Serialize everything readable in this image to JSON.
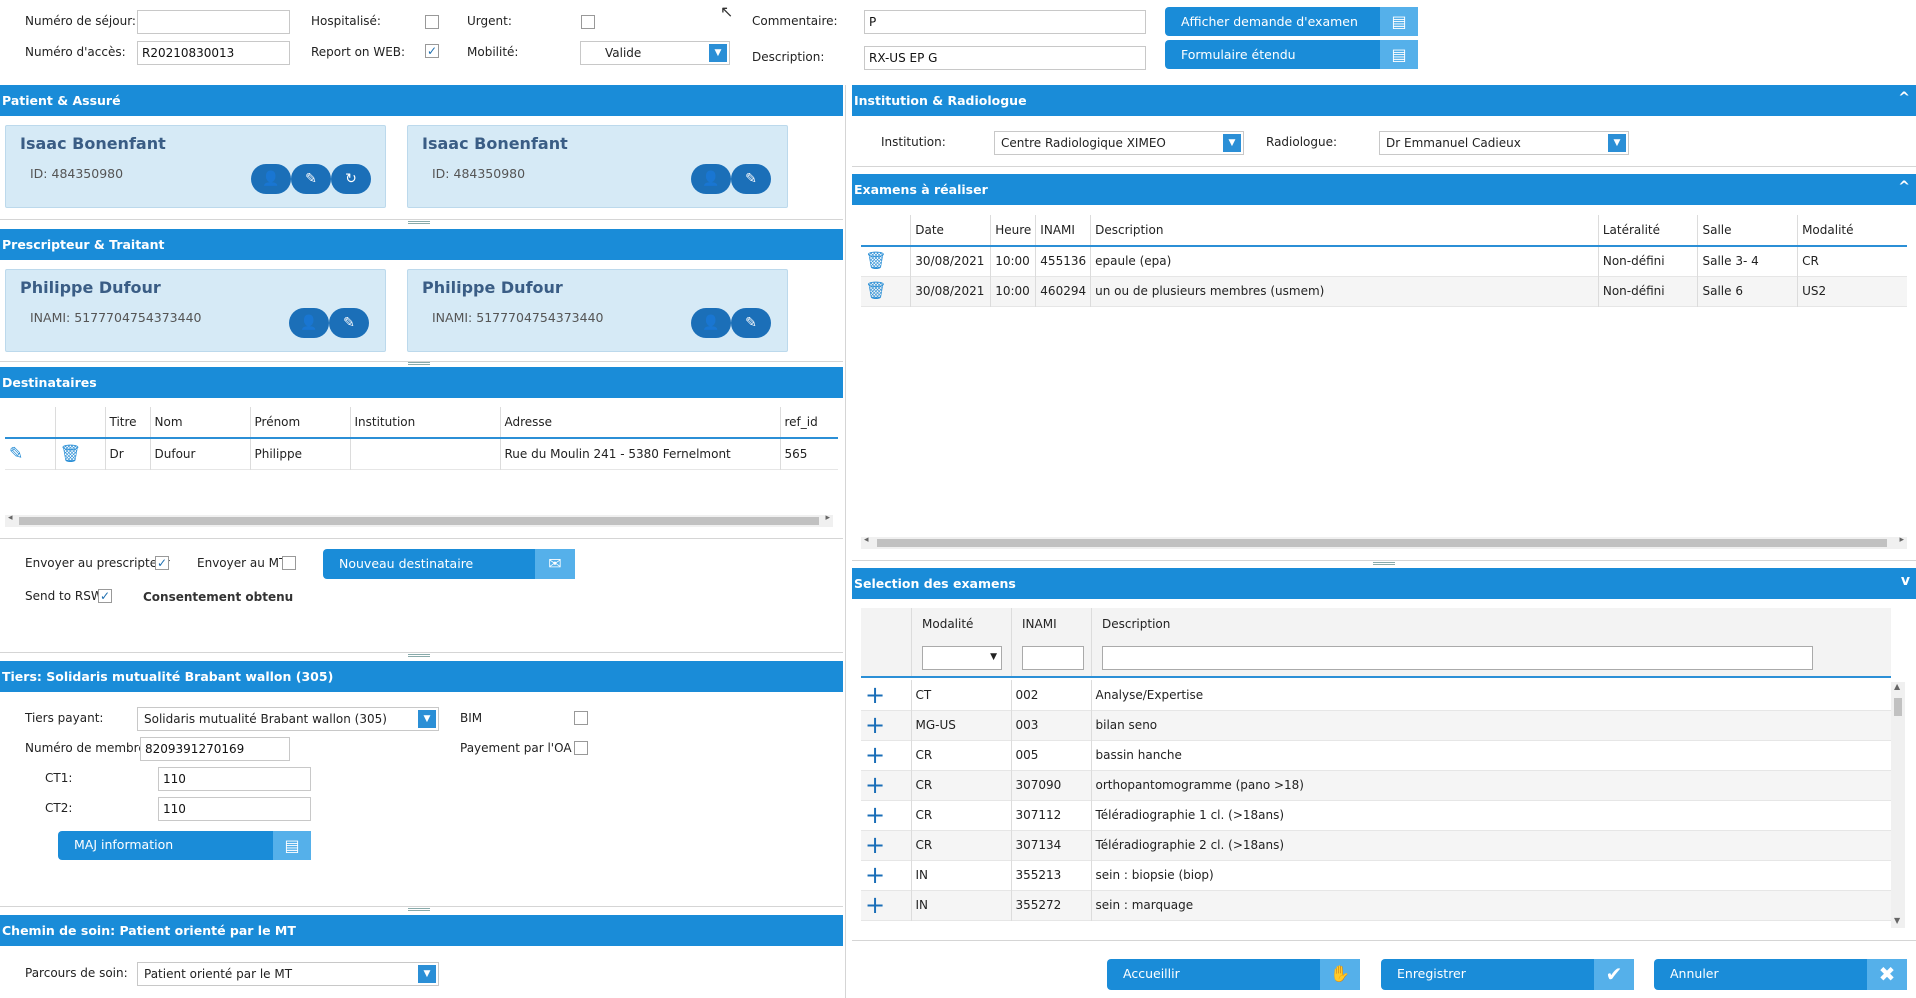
{
  "top_form": {
    "numero_sejour_label": "Numéro de séjour:",
    "numero_sejour_value": "",
    "numero_acces_label": "Numéro d'accès:",
    "numero_acces_value": "R20210830013",
    "hospitalise_label": "Hospitalisé:",
    "hospitalise_checked": false,
    "report_web_label": "Report on WEB:",
    "report_web_checked": true,
    "urgent_label": "Urgent:",
    "urgent_checked": false,
    "mobilite_label": "Mobilité:",
    "mobilite_value": "Valide",
    "commentaire_label": "Commentaire:",
    "commentaire_value": "P",
    "description_label": "Description:",
    "description_value": "RX-US EP G",
    "afficher_demande_label": "Afficher demande d'examen",
    "formulaire_etendu_label": "Formulaire étendu"
  },
  "patient_assure": {
    "title": "Patient & Assuré",
    "patient_name": "Isaac Bonenfant",
    "patient_id": "ID: 484350980",
    "assure_name": "Isaac Bonenfant",
    "assure_id": "ID: 484350980"
  },
  "prescripteur_traitant": {
    "title": "Prescripteur & Traitant",
    "prescripteur_name": "Philippe Dufour",
    "prescripteur_inami": "INAMI: 51777047543734​40",
    "traitant_name": "Philippe Dufour",
    "traitant_inami": "INAMI: 5177704754373440"
  },
  "destinataires": {
    "title": "Destinataires",
    "columns": [
      "Titre",
      "Nom",
      "Prénom",
      "Institution",
      "Adresse",
      "ref_id"
    ],
    "rows": [
      {
        "titre": "Dr",
        "nom": "Dufour",
        "prenom": "Philippe",
        "institution": "",
        "adresse": "Rue du Moulin 241 - 5380 Fernelmont",
        "ref_id": "565"
      }
    ],
    "envoyer_prescripteur_label": "Envoyer au prescripteur",
    "envoyer_prescripteur_checked": true,
    "envoyer_mt_label": "Envoyer au MT",
    "envoyer_mt_checked": false,
    "nouveau_destinataire_label": "Nouveau destinataire",
    "send_rsw_label": "Send to RSW",
    "send_rsw_checked": true,
    "consentement_label": "Consentement obtenu"
  },
  "tiers": {
    "title": "Tiers: Solidaris mutualité Brabant wallon (305)",
    "tiers_payant_label": "Tiers payant:",
    "tiers_payant_value": "Solidaris mutualité Brabant wallon (305)",
    "numero_membre_label": "Numéro de membre:",
    "numero_membre_value": "8209391270169",
    "ct1_label": "CT1:",
    "ct1_value": "110",
    "ct2_label": "CT2:",
    "ct2_value": "110",
    "bim_label": "BIM",
    "bim_checked": false,
    "payement_oa_label": "Payement par l'OA",
    "payement_oa_checked": false,
    "maj_label": "MAJ information"
  },
  "chemin_soin": {
    "title": "Chemin de soin: Patient orienté par le MT",
    "parcours_label": "Parcours de soin:",
    "parcours_value": "Patient orienté par le MT"
  },
  "institution_radiologue": {
    "title": "Institution & Radiologue",
    "institution_label": "Institution:",
    "institution_value": "Centre Radiologique XIMEO",
    "radiologue_label": "Radiologue:",
    "radiologue_value": "Dr Emmanuel Cadieux"
  },
  "examens": {
    "title": "Examens à réaliser",
    "columns": [
      "Date",
      "Heure",
      "INAMI",
      "Description",
      "Latéralité",
      "Salle",
      "Modalité"
    ],
    "rows": [
      {
        "date": "30/08/2021",
        "heure": "10:00",
        "inami": "455136",
        "description": "epaule (epa)",
        "lateralite": "Non-défini",
        "salle": "Salle 3- 4",
        "modalite": "CR"
      },
      {
        "date": "30/08/2021",
        "heure": "10:00",
        "inami": "460294",
        "description": "un ou de plusieurs membres (usmem)",
        "lateralite": "Non-défini",
        "salle": "Salle 6",
        "modalite": "US2"
      }
    ]
  },
  "selection": {
    "title": "Selection des examens",
    "columns": [
      "Modalité",
      "INAMI",
      "Description"
    ],
    "rows": [
      {
        "modalite": "CT",
        "inami": "002",
        "description": "Analyse/Expertise"
      },
      {
        "modalite": "MG-US",
        "inami": "003",
        "description": "bilan seno"
      },
      {
        "modalite": "CR",
        "inami": "005",
        "description": "bassin hanche"
      },
      {
        "modalite": "CR",
        "inami": "307090",
        "description": "orthopantomogramme (pano >18)"
      },
      {
        "modalite": "CR",
        "inami": "307112",
        "description": "Téléradiographie 1 cl. (>18ans)"
      },
      {
        "modalite": "CR",
        "inami": "307134",
        "description": "Téléradiographie 2 cl. (>18ans)"
      },
      {
        "modalite": "IN",
        "inami": "355213",
        "description": "sein : biopsie (biop)"
      },
      {
        "modalite": "IN",
        "inami": "355272",
        "description": "sein : marquage"
      }
    ]
  },
  "footer": {
    "accueillir_label": "Accueillir",
    "enregistrer_label": "Enregistrer",
    "annuler_label": "Annuler"
  },
  "colors": {
    "accent": "#1a8cd8",
    "card_bg": "#d6eaf6",
    "card_button": "#1b6fb8"
  }
}
